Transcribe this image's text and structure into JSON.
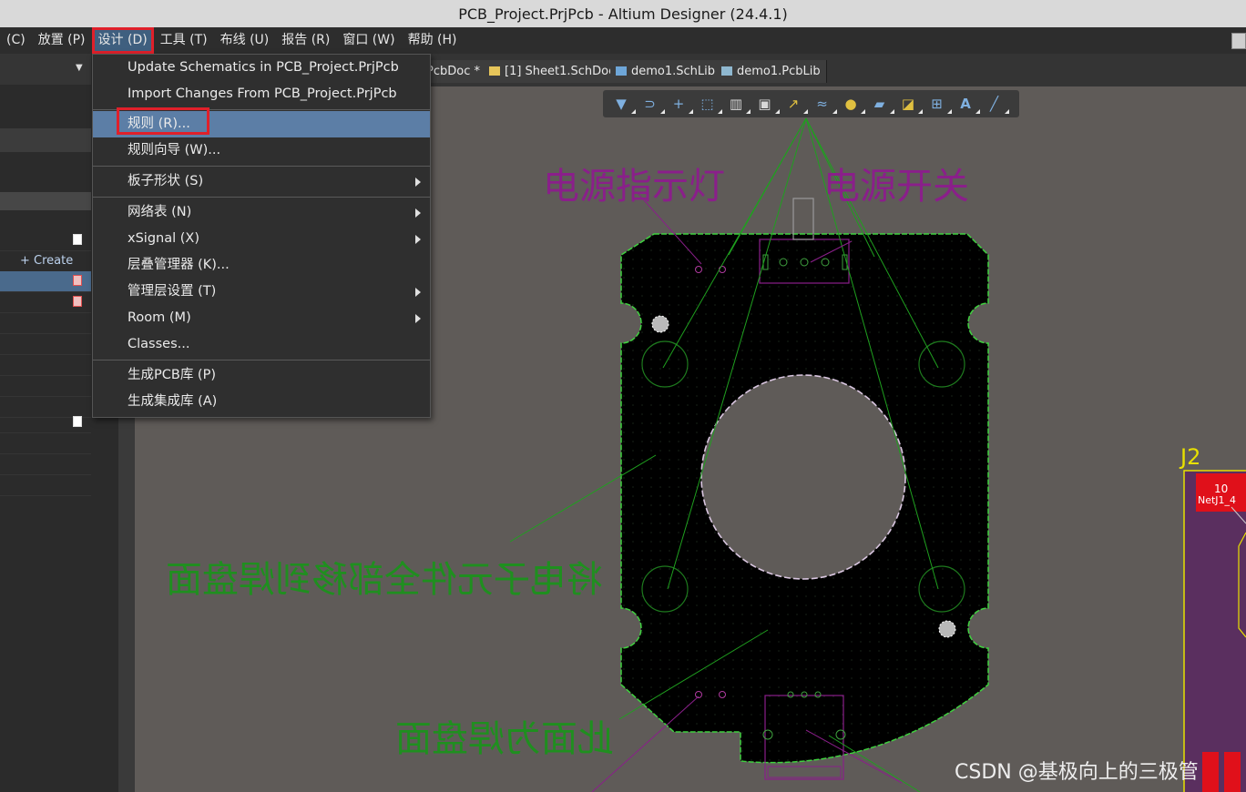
{
  "window": {
    "title": "PCB_Project.PrjPcb - Altium Designer (24.4.1)"
  },
  "menubar": {
    "items": [
      "(C)",
      "放置 (P)",
      "设计 (D)",
      "工具 (T)",
      "布线 (U)",
      "报告 (R)",
      "窗口 (W)",
      "帮助 (H)"
    ],
    "active_index": 2
  },
  "left_panel": {
    "create_label": "+ Create"
  },
  "tabs": [
    {
      "label": "PcbDoc *",
      "icon": "pcb-doc-icon"
    },
    {
      "label": "[1] Sheet1.SchDoc",
      "icon": "schdoc-icon"
    },
    {
      "label": "demo1.SchLib",
      "icon": "schlib-icon"
    },
    {
      "label": "demo1.PcbLib",
      "icon": "pcblib-icon"
    }
  ],
  "toolbar": {
    "icons": [
      "filter-icon",
      "magnet-icon",
      "cross-icon",
      "select-rect-icon",
      "chart-icon",
      "chip-icon",
      "route-icon",
      "diff-pair-icon",
      "pin-icon",
      "polygon-icon",
      "graph-icon",
      "dimension-icon",
      "text-icon",
      "line-icon"
    ]
  },
  "design_menu": {
    "items": [
      {
        "label": "Update Schematics in PCB_Project.PrjPcb",
        "submenu": false
      },
      {
        "label": "Import Changes From PCB_Project.PrjPcb",
        "submenu": false
      },
      {
        "label": "规则 (R)...",
        "submenu": false,
        "highlighted": true
      },
      {
        "label": "规则向导 (W)...",
        "submenu": false
      },
      {
        "label": "板子形状 (S)",
        "submenu": true
      },
      {
        "label": "网络表 (N)",
        "submenu": true
      },
      {
        "label": "xSignal (X)",
        "submenu": true
      },
      {
        "label": "层叠管理器 (K)...",
        "submenu": false
      },
      {
        "label": "管理层设置 (T)",
        "submenu": true
      },
      {
        "label": "Room (M)",
        "submenu": true
      },
      {
        "label": "Classes...",
        "submenu": false
      },
      {
        "label": "生成PCB库 (P)",
        "submenu": false
      },
      {
        "label": "生成集成库 (A)",
        "submenu": false
      }
    ]
  },
  "pcb": {
    "annotation_power_led": "电源指示灯",
    "annotation_power_switch": "电源开关",
    "annotation_move_to_pad": "将电子元件全部移到焊盘面",
    "annotation_pad_side": "此面为焊盘面",
    "component_designator": "J2",
    "pad_number": "10",
    "pad_net": "NetJ1_4"
  },
  "watermark": "CSDN @基极向上的三极管",
  "colors": {
    "accent_red": "#e0202a",
    "menu_highlight": "#5c7ea6",
    "annotation_purple": "#8a1f8a",
    "annotation_green": "#1f8f1f",
    "board_outline": "#3fd13f"
  }
}
